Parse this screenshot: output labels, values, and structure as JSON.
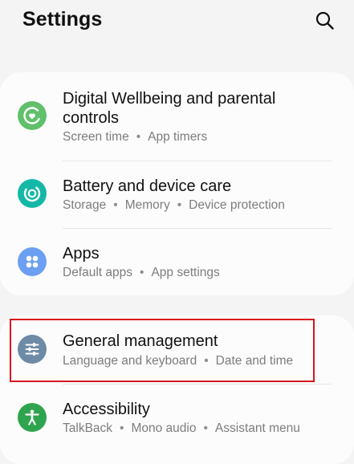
{
  "header": {
    "title": "Settings",
    "search_icon": "search-icon"
  },
  "colors": {
    "wellbeing": "#61c06b",
    "battery": "#14b8a6",
    "apps": "#6c9ff2",
    "general": "#6d8aa6",
    "accessibility": "#2ea44f",
    "highlight": "#d7161e"
  },
  "items": [
    {
      "title_lines": [
        "Digital Wellbeing and parental",
        "controls"
      ],
      "subtitle_parts": [
        "Screen time",
        "App timers"
      ],
      "icon": "wellbeing-icon"
    },
    {
      "title": "Battery and device care",
      "subtitle_parts": [
        "Storage",
        "Memory",
        "Device protection"
      ],
      "icon": "device-care-icon"
    },
    {
      "title": "Apps",
      "subtitle_parts": [
        "Default apps",
        "App settings"
      ],
      "icon": "apps-icon"
    },
    {
      "title": "General management",
      "subtitle_parts": [
        "Language and keyboard",
        "Date and time"
      ],
      "icon": "sliders-icon"
    },
    {
      "title": "Accessibility",
      "subtitle_parts": [
        "TalkBack",
        "Mono audio",
        "Assistant menu"
      ],
      "icon": "accessibility-icon"
    }
  ],
  "separator": "•"
}
